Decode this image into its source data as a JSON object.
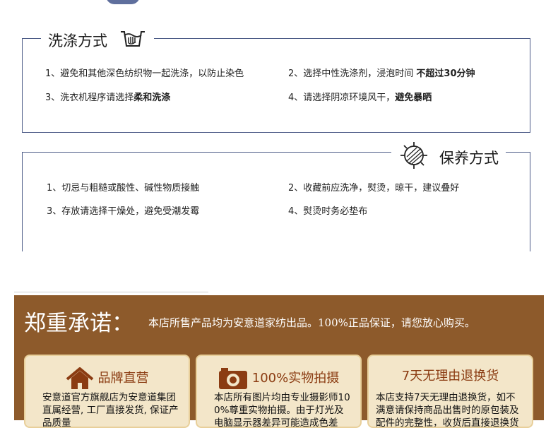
{
  "wash": {
    "title": "洗涤方式",
    "items": [
      "1、避免和其他深色纺织物一起洗涤，以防止染色",
      "2、选择中性洗涤剂，浸泡时间 ",
      "不超过30分钟",
      "3、洗衣机程序请选择",
      "柔和洗涤",
      "4、请选择阴凉环境风干，",
      "避免暴晒"
    ]
  },
  "keep": {
    "title": "保养方式",
    "items": [
      "1、切忌与粗糙或酸性、碱性物质接触",
      "2、收藏前应洗净，熨烫，晾干，建议叠好",
      "3、存放请选择干燥处，避免受潮发霉",
      "4、熨烫时务必垫布"
    ]
  },
  "promise": {
    "heading": "郑重承诺：",
    "text": "本店所售产品均为安意道家纺出品。100%正品保证，请您放心购买。",
    "cards": [
      {
        "icon": "home-icon",
        "title": "品牌直营",
        "body": "安意道官方旗舰店为安意道集团直属经营, 工厂直接发货, 保证产品质量"
      },
      {
        "icon": "camera-icon",
        "title": "100%实物拍摄",
        "body": "本店所有图片均由专业摄影师100%尊重实物拍摄。由于灯光及电脑显示器差异可能造成色差"
      },
      {
        "icon": "",
        "title": "7天无理由退换货",
        "body": "本店支持7天无理由退换货，如不满意请保持商品出售时的原包装及配件的完整性，收货后直接退换货"
      }
    ]
  },
  "colors": {
    "frame": "#4b5a86",
    "banner": "#8d5a2b",
    "card_bg": "#f3e6c9",
    "card_title": "#8b3c12"
  }
}
